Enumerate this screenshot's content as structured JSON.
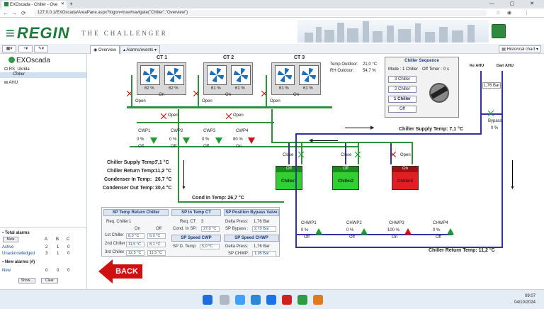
{
  "browser": {
    "tab_title": "EXOscada - Chiller - Ove",
    "url": "127.0.0.1/EXOscada/AreaPane.aspx?logon=true#navigate(\"Chiller\",\"Overview\")"
  },
  "header": {
    "brand": "REGIN",
    "tagline": "THE   CHALLENGER"
  },
  "tree": {
    "root": "EXOscada",
    "site": "RS_Ukrida",
    "selected": "Chiller",
    "other": "AHU"
  },
  "tabs": {
    "overview": "Overview",
    "alarms": "Alarms/events",
    "historical": "Historical chart"
  },
  "cooling_towers": [
    {
      "label": "CT 1",
      "fan_a": "62 %",
      "fan_b": "62 %",
      "state": "On",
      "valve": "Open"
    },
    {
      "label": "CT 2",
      "fan_a": "61 %",
      "fan_b": "61 %",
      "state": "On",
      "valve": "Open"
    },
    {
      "label": "CT 3",
      "fan_a": "61 %",
      "fan_b": "61 %",
      "state": "On",
      "valve": "Open"
    }
  ],
  "weather": {
    "temp_label": "Temp Outdoor:",
    "temp": "21,0 °C",
    "rh_label": "RH Outdoor:",
    "rh": "54,7 %"
  },
  "sequence": {
    "title": "Chiller Sequence",
    "mode_label": "Mode :",
    "mode": "1 Chiller",
    "timer_label": "Off Timer :",
    "timer": "0 s",
    "options": [
      "3 Chiller",
      "2 Chiller",
      "1 Chiller",
      "Off"
    ]
  },
  "ahu": {
    "ke": "Ke AHU",
    "dari": "Dari AHU",
    "pressure": "1,76 Bar",
    "bypass_label": "Bypass",
    "bypass": "0 %"
  },
  "valves_mid": {
    "v1": "Open",
    "v2": "Open"
  },
  "cwp": [
    {
      "label": "CWP1",
      "pct": "0 %",
      "state": "Off"
    },
    {
      "label": "CWP2",
      "pct": "0 %",
      "state": "Off"
    },
    {
      "label": "CWP3",
      "pct": "0 %",
      "state": "Off"
    },
    {
      "label": "CWP4",
      "pct": "80 %",
      "state": "On"
    }
  ],
  "supply_temp": "Chiller Supply Temp:  7,1 °C",
  "chillers": [
    {
      "name": "Chiller1",
      "state": "Off",
      "valve": "Close"
    },
    {
      "name": "Chiller2",
      "state": "Off",
      "valve": "Close"
    },
    {
      "name": "Chiller3",
      "state": "On",
      "valve": "Open"
    }
  ],
  "temps": [
    {
      "label": "Chiller Supply Temp:",
      "value": "7,1 °C"
    },
    {
      "label": "Chiller Return Temp:",
      "value": "11,2 °C"
    },
    {
      "label": "Condenser  In Temp:",
      "value": "26,7 °C"
    },
    {
      "label": "Condenser Out Temp:",
      "value": "30,4 °C"
    }
  ],
  "cond_in": "Cond  In Temp:  26,7 °C",
  "sp_table": {
    "h1": "SP Temp Return Chiller",
    "req_label": "Req. Chiller",
    "req": "1",
    "col_on": "On",
    "col_off": "Off",
    "rows": [
      {
        "label": "1st Chiller",
        "on": "8,0 °C",
        "off": "6,0 °C"
      },
      {
        "label": "2nd Chiller",
        "on": "11,5 °C",
        "off": "8,1 °C"
      },
      {
        "label": "3rd Chiller",
        "on": "12,5 °C",
        "off": "11,5 °C"
      }
    ],
    "h2": "SP In Temp CT",
    "req_ct_label": "Req. CT",
    "req_ct": "3",
    "cond_sp_label": "Cond. In SP:",
    "cond_sp": "27,0 °C",
    "h3": "SP Speed CWP",
    "dtemp_label": "SP D. Temp:",
    "dtemp": "5,0 °C",
    "h4": "SP Position Bypass Valve",
    "dpress_label": "Delta Press:",
    "dpress": "1,76 Bar",
    "spbypass_label": "SP Bypass :",
    "spbypass": "2,70 Bar",
    "h5": "SP Speed CHWP",
    "dpress2_label": "Delta Press:",
    "dpress2": "1,76 Bar",
    "spchwp_label": "SP CHWP:",
    "spchwp": "1,95 Bar"
  },
  "chwp": [
    {
      "label": "CHWP1",
      "pct": "0 %",
      "state": "Off"
    },
    {
      "label": "CHWP2",
      "pct": "0 %",
      "state": "Off"
    },
    {
      "label": "CHWP3",
      "pct": "100 %",
      "state": "On"
    },
    {
      "label": "CHWP4",
      "pct": "0 %",
      "state": "Off"
    }
  ],
  "return_temp": "Chiller Return Temp:  11,2 °C",
  "back_label": "BACK",
  "alarms": {
    "total_title": "Total alarms",
    "cols": [
      "A",
      "B",
      "C"
    ],
    "mute": "Mute",
    "active_label": "Active",
    "active": [
      "2",
      "1",
      "0"
    ],
    "unack_label": "Unacknowledged",
    "unack": [
      "3",
      "1",
      "0"
    ],
    "new_title": "New alarms (#)",
    "new_label": "New",
    "new": [
      "0",
      "0",
      "0"
    ],
    "show": "Show...",
    "clear": "Clear"
  },
  "clock": {
    "time": "09:07",
    "date": "04/10/2024"
  }
}
